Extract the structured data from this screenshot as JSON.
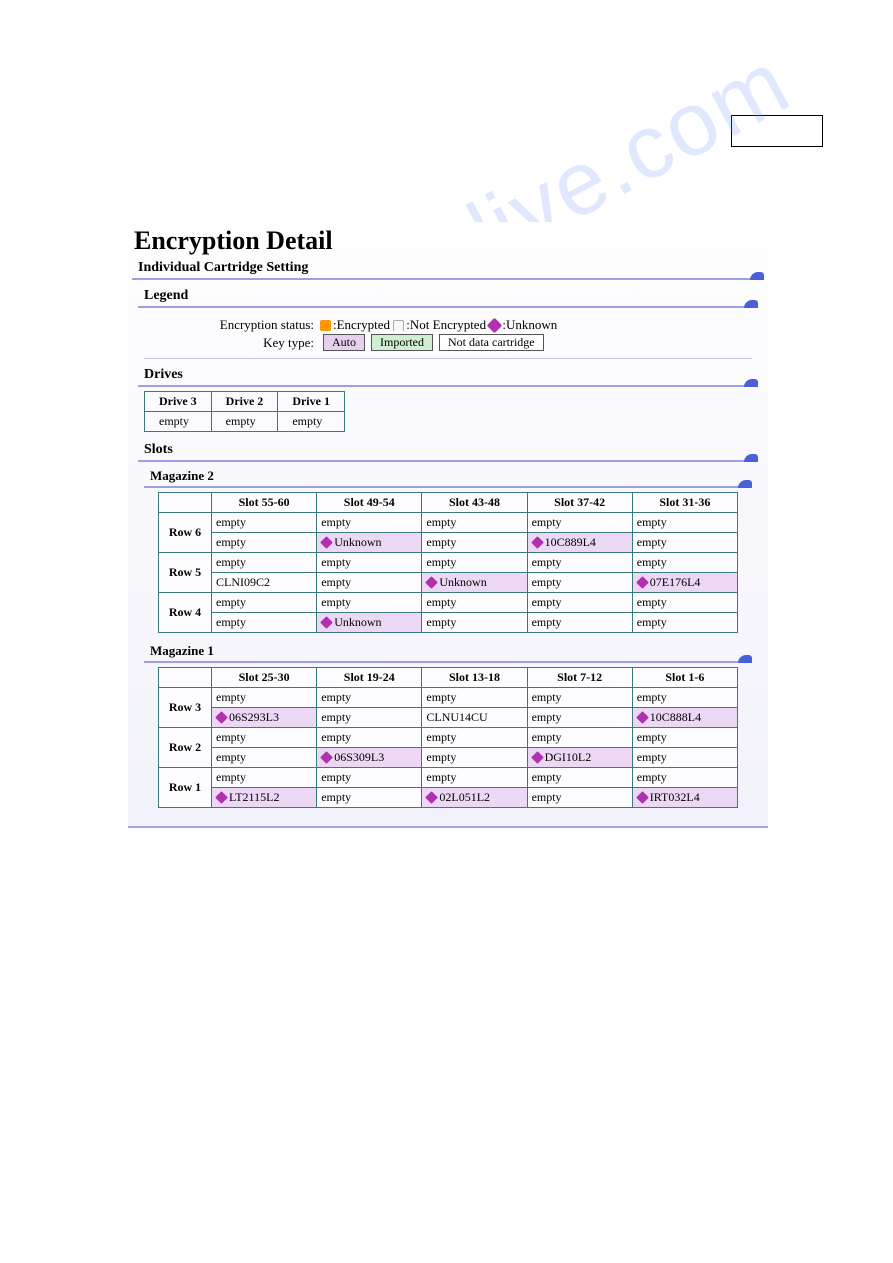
{
  "title": "Encryption Detail",
  "section_individual": "Individual Cartridge Setting",
  "legend": {
    "header": "Legend",
    "status_label": "Encryption status:",
    "encrypted": ":Encrypted",
    "not_encrypted": ":Not Encrypted",
    "unknown": ":Unknown",
    "key_type_label": "Key type:",
    "auto": "Auto",
    "imported": "Imported",
    "not_data_cartridge": "Not data cartridge"
  },
  "drives": {
    "header": "Drives",
    "columns": [
      "Drive 3",
      "Drive 2",
      "Drive 1"
    ],
    "values": [
      "empty",
      "empty",
      "empty"
    ]
  },
  "slots_header": "Slots",
  "magazines": [
    {
      "name": "Magazine 2",
      "columns": [
        "Slot 55-60",
        "Slot 49-54",
        "Slot 43-48",
        "Slot 37-42",
        "Slot 31-36"
      ],
      "rows": [
        {
          "label": "Row 6",
          "top": [
            {
              "t": "empty"
            },
            {
              "t": "empty"
            },
            {
              "t": "empty"
            },
            {
              "t": "empty"
            },
            {
              "t": "empty"
            }
          ],
          "bottom": [
            {
              "t": "empty"
            },
            {
              "t": "Unknown",
              "k": "auto",
              "i": 1
            },
            {
              "t": "empty"
            },
            {
              "t": "10C889L4",
              "k": "auto",
              "i": 1
            },
            {
              "t": "empty"
            }
          ]
        },
        {
          "label": "Row 5",
          "top": [
            {
              "t": "empty"
            },
            {
              "t": "empty"
            },
            {
              "t": "empty"
            },
            {
              "t": "empty"
            },
            {
              "t": "empty"
            }
          ],
          "bottom": [
            {
              "t": "CLNI09C2"
            },
            {
              "t": "empty"
            },
            {
              "t": "Unknown",
              "k": "auto",
              "i": 1
            },
            {
              "t": "empty"
            },
            {
              "t": "07E176L4",
              "k": "auto",
              "i": 1
            }
          ]
        },
        {
          "label": "Row 4",
          "top": [
            {
              "t": "empty"
            },
            {
              "t": "empty"
            },
            {
              "t": "empty"
            },
            {
              "t": "empty"
            },
            {
              "t": "empty"
            }
          ],
          "bottom": [
            {
              "t": "empty"
            },
            {
              "t": "Unknown",
              "k": "auto",
              "i": 1
            },
            {
              "t": "empty"
            },
            {
              "t": "empty"
            },
            {
              "t": "empty"
            }
          ]
        }
      ]
    },
    {
      "name": "Magazine 1",
      "columns": [
        "Slot 25-30",
        "Slot 19-24",
        "Slot 13-18",
        "Slot 7-12",
        "Slot 1-6"
      ],
      "rows": [
        {
          "label": "Row 3",
          "top": [
            {
              "t": "empty"
            },
            {
              "t": "empty"
            },
            {
              "t": "empty"
            },
            {
              "t": "empty"
            },
            {
              "t": "empty"
            }
          ],
          "bottom": [
            {
              "t": "06S293L3",
              "k": "auto",
              "i": 1
            },
            {
              "t": "empty"
            },
            {
              "t": "CLNU14CU"
            },
            {
              "t": "empty"
            },
            {
              "t": "10C888L4",
              "k": "auto",
              "i": 1
            }
          ]
        },
        {
          "label": "Row 2",
          "top": [
            {
              "t": "empty"
            },
            {
              "t": "empty"
            },
            {
              "t": "empty"
            },
            {
              "t": "empty"
            },
            {
              "t": "empty"
            }
          ],
          "bottom": [
            {
              "t": "empty"
            },
            {
              "t": "06S309L3",
              "k": "auto",
              "i": 1
            },
            {
              "t": "empty"
            },
            {
              "t": "DGI10L2",
              "k": "auto",
              "i": 1
            },
            {
              "t": "empty"
            }
          ]
        },
        {
          "label": "Row 1",
          "top": [
            {
              "t": "empty"
            },
            {
              "t": "empty"
            },
            {
              "t": "empty"
            },
            {
              "t": "empty"
            },
            {
              "t": "empty"
            }
          ],
          "bottom": [
            {
              "t": "LT2115L2",
              "k": "auto",
              "i": 1
            },
            {
              "t": "empty"
            },
            {
              "t": "02L051L2",
              "k": "auto",
              "i": 1
            },
            {
              "t": "empty"
            },
            {
              "t": "IRT032L4",
              "k": "auto",
              "i": 1
            }
          ]
        }
      ]
    }
  ],
  "watermark": "manualslive.com"
}
